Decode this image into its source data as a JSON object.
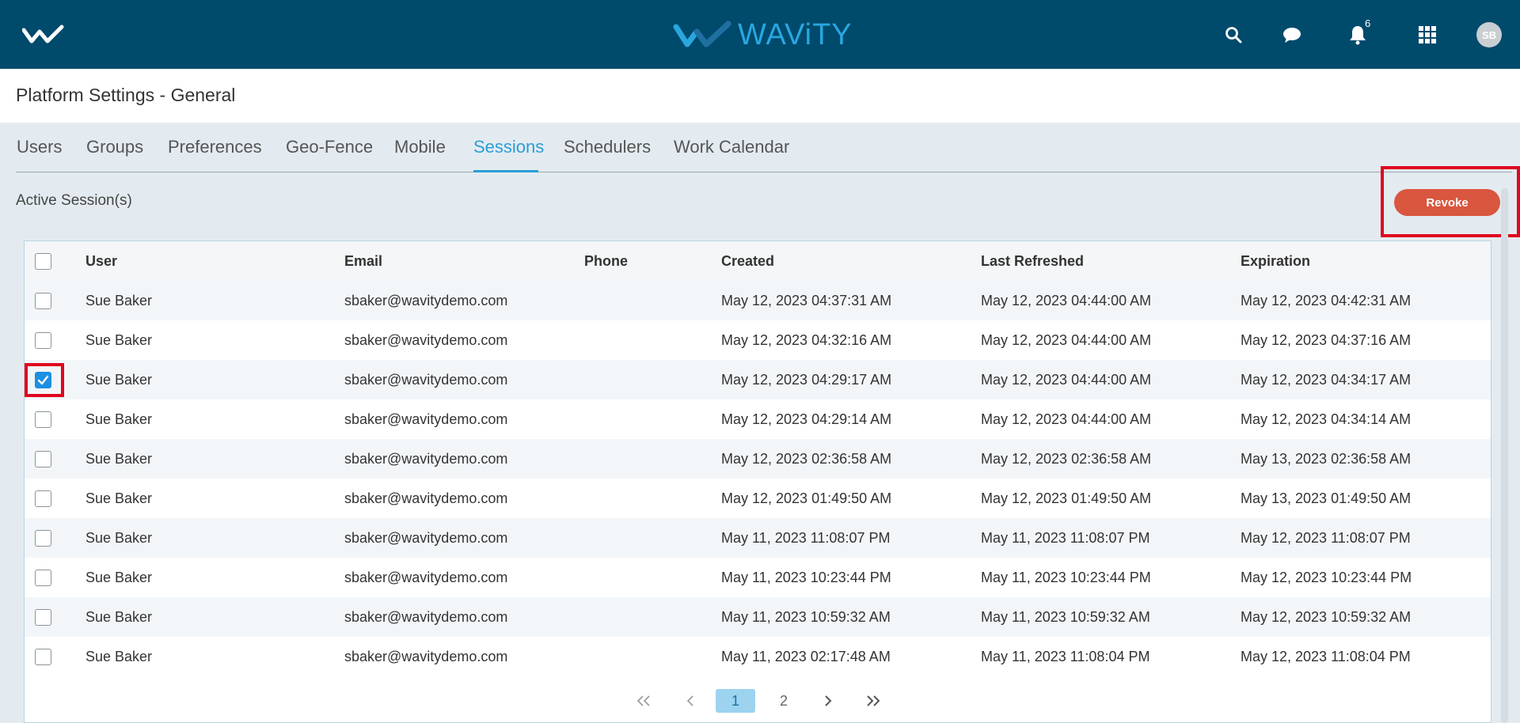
{
  "app": {
    "brand_name": "WAViTY",
    "brand_color": "#2aa6df",
    "header_color": "#004a6c"
  },
  "topbar": {
    "icons": [
      "home-logo-icon",
      "search-icon",
      "chat-icon",
      "bell-icon",
      "apps-grid-icon"
    ],
    "notification_count": "6",
    "avatar_initials": "SB"
  },
  "page": {
    "title": "Platform Settings - General"
  },
  "tabs": [
    {
      "label": "Users"
    },
    {
      "label": "Groups"
    },
    {
      "label": "Preferences"
    },
    {
      "label": "Geo-Fence"
    },
    {
      "label": "Mobile"
    },
    {
      "label": "Sessions",
      "active": true
    },
    {
      "label": "Schedulers"
    },
    {
      "label": "Work Calendar"
    }
  ],
  "section": {
    "label": "Active Session(s)"
  },
  "actions": {
    "revoke_label": "Revoke",
    "revoke_color": "#d9563f"
  },
  "table": {
    "columns": [
      "User",
      "Email",
      "Phone",
      "Created",
      "Last Refreshed",
      "Expiration"
    ],
    "rows": [
      {
        "checked": false,
        "user": "Sue Baker",
        "email": "sbaker@wavitydemo.com",
        "phone": "",
        "created": "May 12, 2023 04:37:31 AM",
        "last_refreshed": "May 12, 2023 04:44:00 AM",
        "expiration": "May 12, 2023 04:42:31 AM"
      },
      {
        "checked": false,
        "user": "Sue Baker",
        "email": "sbaker@wavitydemo.com",
        "phone": "",
        "created": "May 12, 2023 04:32:16 AM",
        "last_refreshed": "May 12, 2023 04:44:00 AM",
        "expiration": "May 12, 2023 04:37:16 AM"
      },
      {
        "checked": true,
        "user": "Sue Baker",
        "email": "sbaker@wavitydemo.com",
        "phone": "",
        "created": "May 12, 2023 04:29:17 AM",
        "last_refreshed": "May 12, 2023 04:44:00 AM",
        "expiration": "May 12, 2023 04:34:17 AM"
      },
      {
        "checked": false,
        "user": "Sue Baker",
        "email": "sbaker@wavitydemo.com",
        "phone": "",
        "created": "May 12, 2023 04:29:14 AM",
        "last_refreshed": "May 12, 2023 04:44:00 AM",
        "expiration": "May 12, 2023 04:34:14 AM"
      },
      {
        "checked": false,
        "user": "Sue Baker",
        "email": "sbaker@wavitydemo.com",
        "phone": "",
        "created": "May 12, 2023 02:36:58 AM",
        "last_refreshed": "May 12, 2023 02:36:58 AM",
        "expiration": "May 13, 2023 02:36:58 AM"
      },
      {
        "checked": false,
        "user": "Sue Baker",
        "email": "sbaker@wavitydemo.com",
        "phone": "",
        "created": "May 12, 2023 01:49:50 AM",
        "last_refreshed": "May 12, 2023 01:49:50 AM",
        "expiration": "May 13, 2023 01:49:50 AM"
      },
      {
        "checked": false,
        "user": "Sue Baker",
        "email": "sbaker@wavitydemo.com",
        "phone": "",
        "created": "May 11, 2023 11:08:07 PM",
        "last_refreshed": "May 11, 2023 11:08:07 PM",
        "expiration": "May 12, 2023 11:08:07 PM"
      },
      {
        "checked": false,
        "user": "Sue Baker",
        "email": "sbaker@wavitydemo.com",
        "phone": "",
        "created": "May 11, 2023 10:23:44 PM",
        "last_refreshed": "May 11, 2023 10:23:44 PM",
        "expiration": "May 12, 2023 10:23:44 PM"
      },
      {
        "checked": false,
        "user": "Sue Baker",
        "email": "sbaker@wavitydemo.com",
        "phone": "",
        "created": "May 11, 2023 10:59:32 AM",
        "last_refreshed": "May 11, 2023 10:59:32 AM",
        "expiration": "May 12, 2023 10:59:32 AM"
      },
      {
        "checked": false,
        "user": "Sue Baker",
        "email": "sbaker@wavitydemo.com",
        "phone": "",
        "created": "May 11, 2023 02:17:48 AM",
        "last_refreshed": "May 11, 2023 11:08:04 PM",
        "expiration": "May 12, 2023 11:08:04 PM"
      }
    ]
  },
  "pagination": {
    "first_icon": "double-chevron-left-icon",
    "prev_icon": "chevron-left-icon",
    "pages": [
      "1",
      "2"
    ],
    "current_page": "1",
    "next_icon": "chevron-right-icon",
    "last_icon": "double-chevron-right-icon"
  }
}
